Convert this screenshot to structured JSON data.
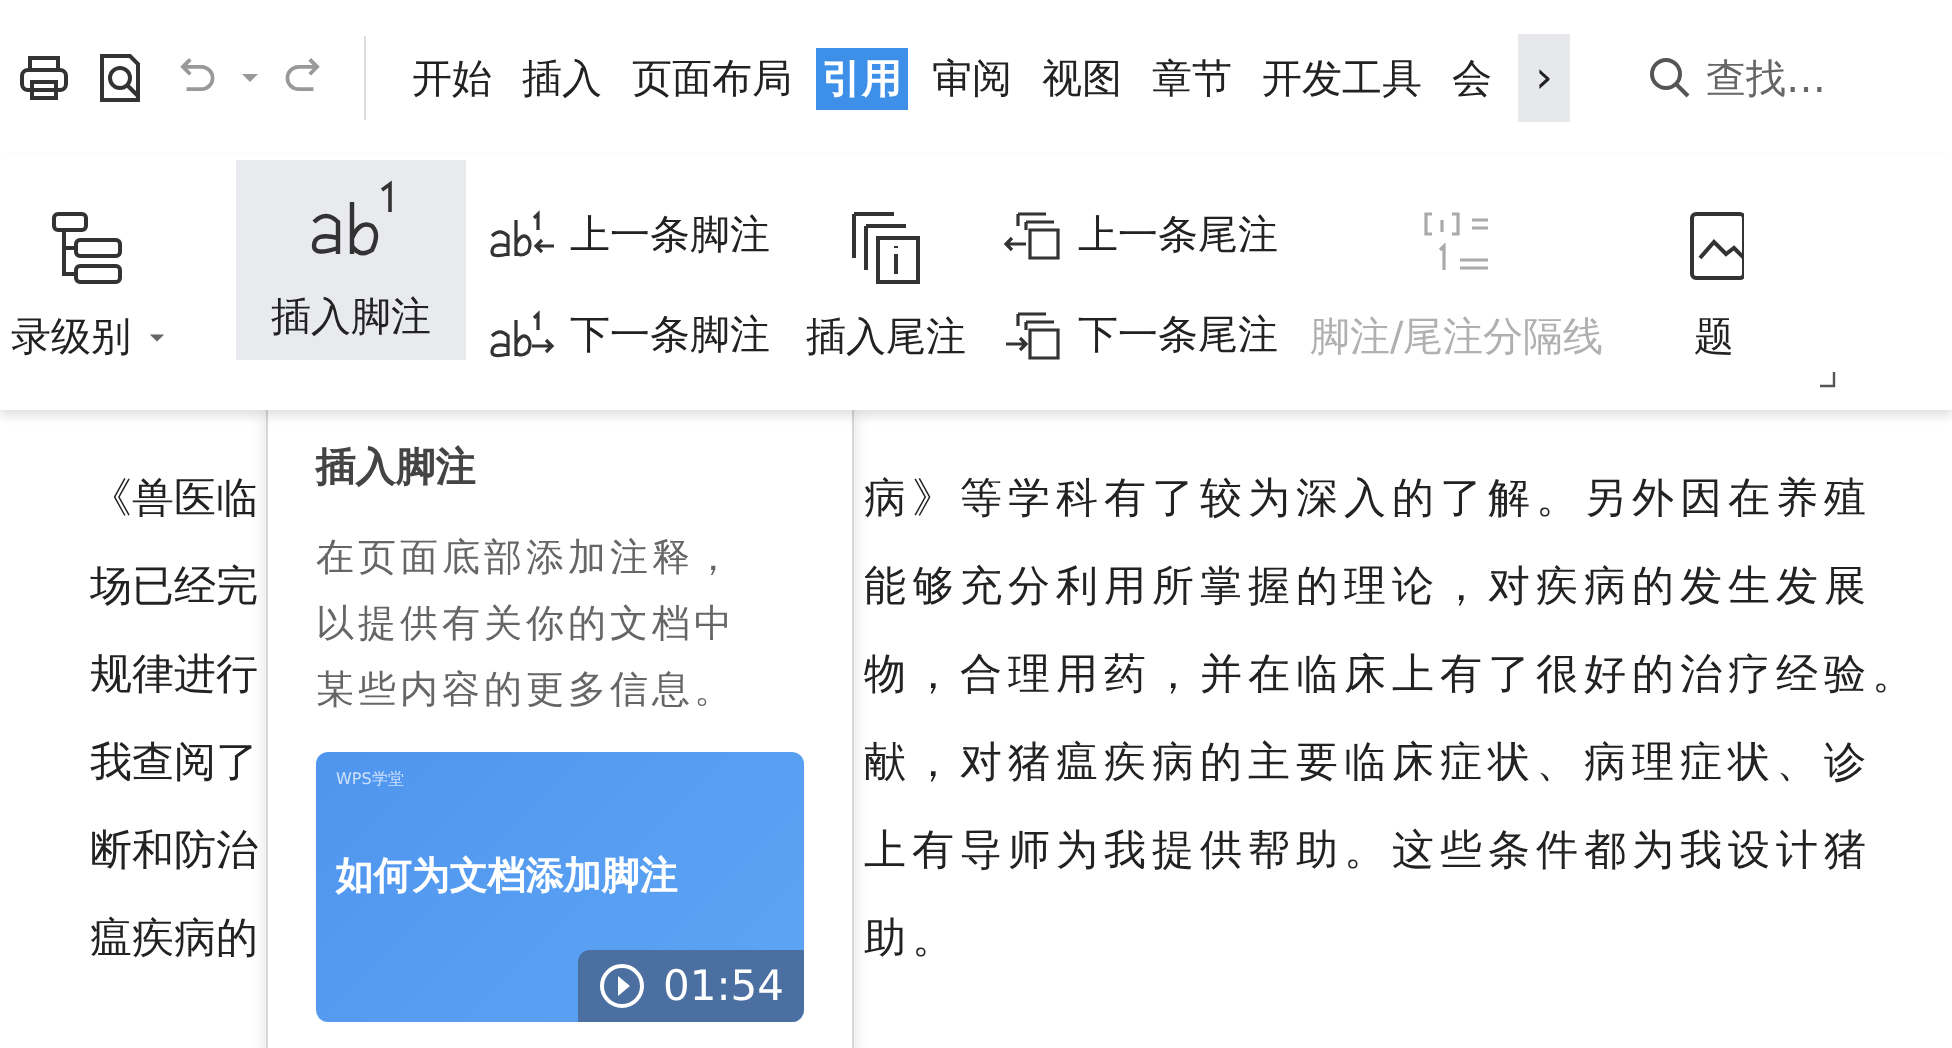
{
  "toolbar": {
    "tabs": [
      {
        "label": "开始",
        "selected": false
      },
      {
        "label": "插入",
        "selected": false
      },
      {
        "label": "页面布局",
        "selected": false
      },
      {
        "label": "引用",
        "selected": true
      },
      {
        "label": "审阅",
        "selected": false
      },
      {
        "label": "视图",
        "selected": false
      },
      {
        "label": "章节",
        "selected": false
      },
      {
        "label": "开发工具",
        "selected": false
      },
      {
        "label": "会",
        "selected": false
      }
    ],
    "scroll_arrow": "›",
    "search": {
      "placeholder": "查找…"
    }
  },
  "ribbon": {
    "items": [
      {
        "kind": "large",
        "label": "录级别",
        "dropdown": true,
        "highlighted": false,
        "disabled": false
      },
      {
        "kind": "large",
        "label": "插入脚注",
        "dropdown": false,
        "highlighted": true,
        "disabled": false
      },
      {
        "kind": "stack",
        "rows": [
          {
            "label": "上一条脚注"
          },
          {
            "label": "下一条脚注"
          }
        ]
      },
      {
        "kind": "large",
        "label": "插入尾注",
        "dropdown": false,
        "highlighted": false,
        "disabled": false
      },
      {
        "kind": "stack",
        "rows": [
          {
            "label": "上一条尾注"
          },
          {
            "label": "下一条尾注"
          }
        ]
      },
      {
        "kind": "large",
        "label": "脚注/尾注分隔线",
        "dropdown": false,
        "highlighted": false,
        "disabled": true
      },
      {
        "kind": "large",
        "label": "题",
        "dropdown": false,
        "highlighted": false,
        "disabled": false
      }
    ]
  },
  "document": {
    "lines": [
      {
        "left": "《兽医临",
        "right": "病》等学科有了较为深入的了解。另外因在养殖"
      },
      {
        "left": "场已经完",
        "right": "能够充分利用所掌握的理论，对疾病的发生发展"
      },
      {
        "left": "规律进行",
        "right": "物，合理用药，并在临床上有了很好的治疗经验。"
      },
      {
        "left": "我查阅了",
        "right": "献，对猪瘟疾病的主要临床症状、病理症状、诊"
      },
      {
        "left": "断和防治",
        "right": "上有导师为我提供帮助。这些条件都为我设计猪"
      },
      {
        "left": "瘟疾病的",
        "right": "助。"
      }
    ]
  },
  "tooltip": {
    "title": "插入脚注",
    "description": "在页面底部添加注释，以提供有关你的文档中某些内容的更多信息。",
    "video": {
      "brand": "WPS学堂",
      "title": "如何为文档添加脚注",
      "duration": "01:54"
    }
  }
}
